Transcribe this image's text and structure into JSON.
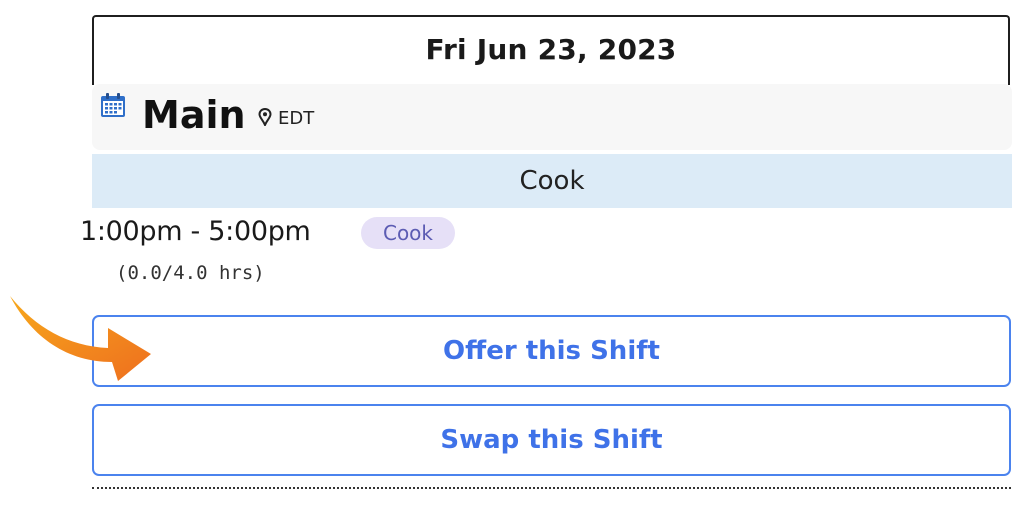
{
  "shift_card": {
    "date": "Fri Jun 23, 2023",
    "location": {
      "icon": "calendar-icon",
      "name": "Main",
      "pin_icon": "map-pin-icon",
      "timezone": "EDT"
    },
    "role_header": "Cook",
    "time_range": "1:00pm - 5:00pm",
    "role_badge": "Cook",
    "hours": "(0.0/4.0 hrs)",
    "actions": {
      "offer_label": "Offer this Shift",
      "swap_label": "Swap this Shift"
    }
  },
  "annotation": {
    "icon": "arrow-pointer-icon",
    "color": "#F28A1E"
  },
  "colors": {
    "accent": "#3F72E8",
    "role_banner": "#DCEBF7",
    "badge_background": "#E6E0F7",
    "badge_text": "#5C5CB3",
    "panel_background": "#F7F7F7"
  }
}
